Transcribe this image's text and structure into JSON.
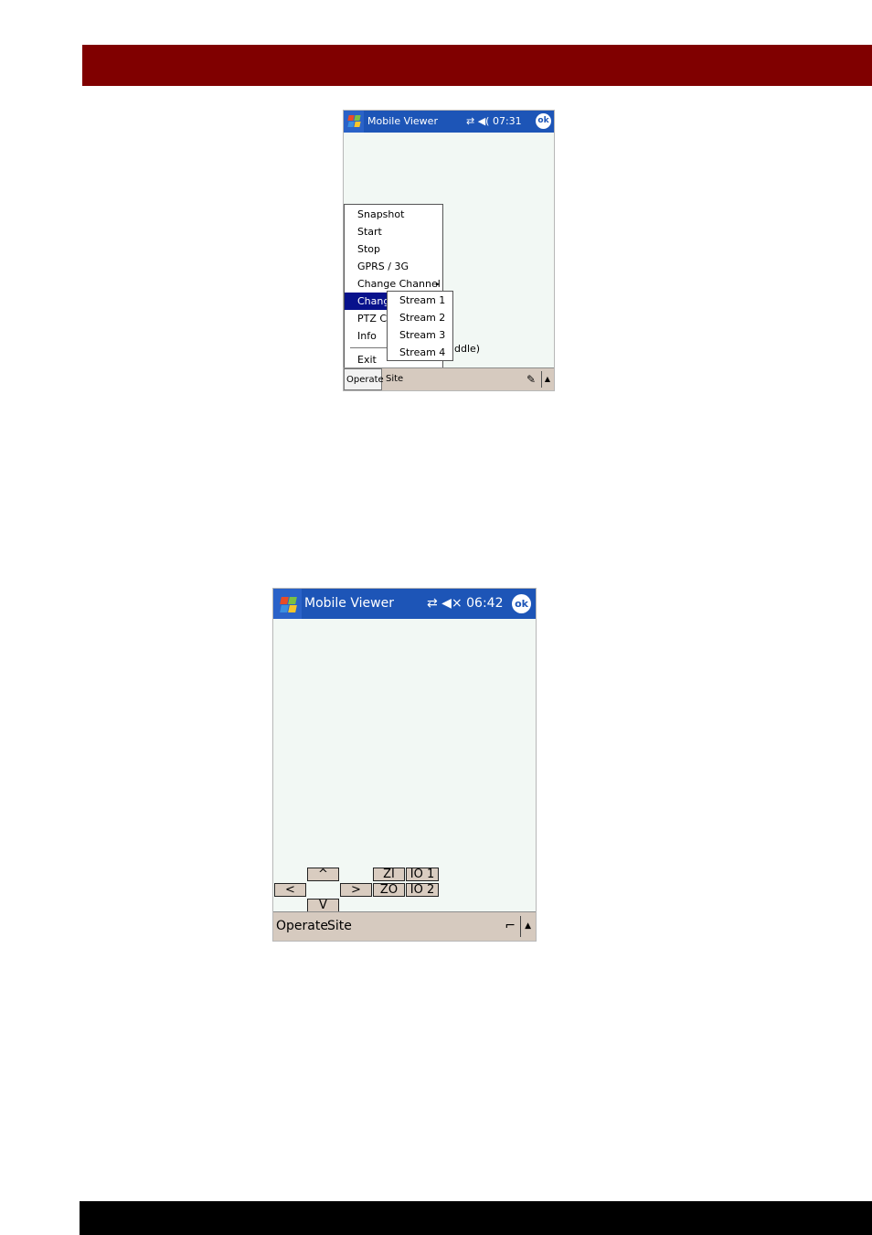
{
  "screen1": {
    "title": "Mobile Viewer",
    "status_icons": "⇄ ◀( ",
    "time": "07:31",
    "ok": "ok",
    "menu": {
      "items": [
        "Snapshot",
        "Start",
        "Stop",
        "GPRS / 3G",
        "Change Channel",
        "Chang",
        "PTZ C",
        "Info",
        "Exit"
      ],
      "submenu_arrow": "▸",
      "highlighted": "Chang"
    },
    "submenu": [
      "Stream 1",
      "Stream 2",
      "Stream 3",
      "Stream 4"
    ],
    "background_text": "ddle)",
    "menubar": {
      "operate": "Operate",
      "site": "Site",
      "pen_icon": "✎",
      "arrow_icon": "▲"
    }
  },
  "screen2": {
    "title": "Mobile Viewer",
    "status_icons": "⇄ ◀×",
    "time": "06:42",
    "ok": "ok",
    "ptz": {
      "up": "^",
      "left": "<",
      "right": ">",
      "down": "V",
      "zoom_in": "ZI",
      "zoom_out": "ZO",
      "io1": "IO 1",
      "io2": "IO 2"
    },
    "menubar": {
      "operate": "Operate",
      "site": "Site",
      "keyboard_icon": "⌐",
      "arrow_icon": "▲"
    }
  },
  "colors": {
    "header_bar": "#800000",
    "footer_bar": "#000000",
    "title_blue": "#1d55b7",
    "menu_highlight": "#08128c"
  }
}
